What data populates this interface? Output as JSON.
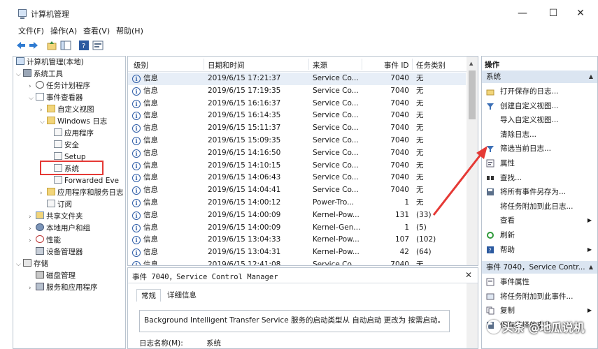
{
  "window": {
    "title": "计算机管理",
    "minimize_glyph": "—",
    "maximize_glyph": "☐",
    "close_glyph": "✕"
  },
  "menu": [
    "文件(F)",
    "操作(A)",
    "查看(V)",
    "帮助(H)"
  ],
  "tree": {
    "root": "计算机管理(本地)",
    "items": [
      {
        "label": "系统工具",
        "icon": "tools-icon"
      },
      {
        "label": "任务计划程序",
        "icon": "clock-icon"
      },
      {
        "label": "事件查看器",
        "icon": "event-viewer-icon"
      },
      {
        "label": "自定义视图",
        "icon": "folder-icon"
      },
      {
        "label": "Windows 日志",
        "icon": "folder-icon"
      },
      {
        "label": "应用程序",
        "icon": "log-icon"
      },
      {
        "label": "安全",
        "icon": "log-icon"
      },
      {
        "label": "Setup",
        "icon": "log-icon"
      },
      {
        "label": "系统",
        "icon": "log-icon"
      },
      {
        "label": "Forwarded Eve",
        "icon": "log-icon"
      },
      {
        "label": "应用程序和服务日志",
        "icon": "folder-icon"
      },
      {
        "label": "订阅",
        "icon": "log-icon"
      },
      {
        "label": "共享文件夹",
        "icon": "share-icon"
      },
      {
        "label": "本地用户和组",
        "icon": "users-icon"
      },
      {
        "label": "性能",
        "icon": "performance-icon"
      },
      {
        "label": "设备管理器",
        "icon": "device-manager-icon"
      },
      {
        "label": "存储",
        "icon": "storage-icon"
      },
      {
        "label": "磁盘管理",
        "icon": "disk-icon"
      },
      {
        "label": "服务和应用程序",
        "icon": "services-icon"
      }
    ]
  },
  "events": {
    "columns": [
      "级别",
      "日期和时间",
      "来源",
      "事件 ID",
      "任务类别"
    ],
    "rows": [
      {
        "level": "信息",
        "datetime": "2019/6/15 17:21:37",
        "source": "Service Co...",
        "id": "7040",
        "category": "无"
      },
      {
        "level": "信息",
        "datetime": "2019/6/15 17:19:35",
        "source": "Service Co...",
        "id": "7040",
        "category": "无"
      },
      {
        "level": "信息",
        "datetime": "2019/6/15 16:16:37",
        "source": "Service Co...",
        "id": "7040",
        "category": "无"
      },
      {
        "level": "信息",
        "datetime": "2019/6/15 16:14:35",
        "source": "Service Co...",
        "id": "7040",
        "category": "无"
      },
      {
        "level": "信息",
        "datetime": "2019/6/15 15:11:37",
        "source": "Service Co...",
        "id": "7040",
        "category": "无"
      },
      {
        "level": "信息",
        "datetime": "2019/6/15 15:09:35",
        "source": "Service Co...",
        "id": "7040",
        "category": "无"
      },
      {
        "level": "信息",
        "datetime": "2019/6/15 14:16:50",
        "source": "Service Co...",
        "id": "7040",
        "category": "无"
      },
      {
        "level": "信息",
        "datetime": "2019/6/15 14:10:15",
        "source": "Service Co...",
        "id": "7040",
        "category": "无"
      },
      {
        "level": "信息",
        "datetime": "2019/6/15 14:06:43",
        "source": "Service Co...",
        "id": "7040",
        "category": "无"
      },
      {
        "level": "信息",
        "datetime": "2019/6/15 14:04:41",
        "source": "Service Co...",
        "id": "7040",
        "category": "无"
      },
      {
        "level": "信息",
        "datetime": "2019/6/15 14:00:12",
        "source": "Power-Tro...",
        "id": "1",
        "category": "无"
      },
      {
        "level": "信息",
        "datetime": "2019/6/15 14:00:09",
        "source": "Kernel-Pow...",
        "id": "131",
        "category": "(33)"
      },
      {
        "level": "信息",
        "datetime": "2019/6/15 14:00:09",
        "source": "Kernel-Gen...",
        "id": "1",
        "category": "(5)"
      },
      {
        "level": "信息",
        "datetime": "2019/6/15 13:04:33",
        "source": "Kernel-Pow...",
        "id": "107",
        "category": "(102)"
      },
      {
        "level": "信息",
        "datetime": "2019/6/15 13:04:31",
        "source": "Kernel-Pow...",
        "id": "42",
        "category": "(64)"
      },
      {
        "level": "信息",
        "datetime": "2019/6/15 12:41:08",
        "source": "Service Co...",
        "id": "7040",
        "category": "无"
      }
    ]
  },
  "detail": {
    "title": "事件 7040，Service Control Manager",
    "tabs": [
      "常规",
      "详细信息"
    ],
    "message": "Background Intelligent Transfer Service 服务的启动类型从 自动启动 更改为 按需启动。",
    "log_name_label": "日志名称(M):",
    "log_name_value": "系统"
  },
  "actions": {
    "title": "操作",
    "section1": "系统",
    "items1": [
      {
        "label": "打开保存的日志...",
        "icon": "open-folder-icon"
      },
      {
        "label": "创建自定义视图...",
        "icon": "filter-icon"
      },
      {
        "label": "导入自定义视图...",
        "icon": ""
      },
      {
        "label": "清除日志...",
        "icon": ""
      },
      {
        "label": "筛选当前日志...",
        "icon": "filter-icon"
      },
      {
        "label": "属性",
        "icon": "properties-icon"
      },
      {
        "label": "查找...",
        "icon": "find-icon"
      },
      {
        "label": "将所有事件另存为...",
        "icon": "save-icon"
      },
      {
        "label": "将任务附加到此日志...",
        "icon": ""
      },
      {
        "label": "查看",
        "icon": "",
        "submenu": true
      },
      {
        "label": "刷新",
        "icon": "refresh-icon"
      },
      {
        "label": "帮助",
        "icon": "help-icon",
        "submenu": true
      }
    ],
    "section2": "事件 7040，Service Contr...",
    "items2": [
      {
        "label": "事件属性",
        "icon": "event-properties-icon"
      },
      {
        "label": "将任务附加到此事件...",
        "icon": "attach-task-icon"
      },
      {
        "label": "复制",
        "icon": "copy-icon",
        "submenu": true
      },
      {
        "label": "保存选择的事件...",
        "icon": "save-icon"
      }
    ]
  },
  "watermark": "头条 @地瓜说机",
  "colors": {
    "annotation_red": "#e53935",
    "selected_row": "#e7eef7",
    "section_header": "#dbe5f1"
  }
}
